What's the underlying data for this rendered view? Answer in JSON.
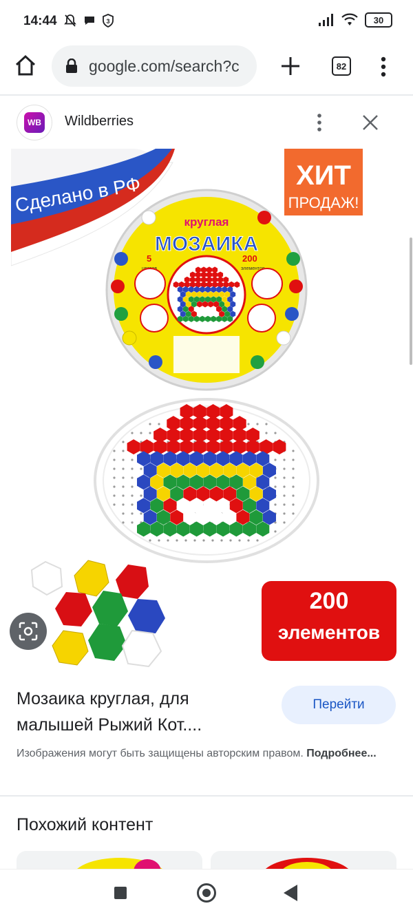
{
  "status_bar": {
    "time": "14:44",
    "battery": "30"
  },
  "browser": {
    "url": "google.com/search?c",
    "tab_count": "82"
  },
  "source": {
    "name": "Wildberries",
    "logo_text": "WB"
  },
  "product_image": {
    "banner_text": "Сделано в РФ",
    "hit_line1": "ХИТ",
    "hit_line2": "ПРОДАЖ!",
    "box_label_small": "круглая",
    "box_label_big": "МОЗАИКА",
    "box_colors_count": "5",
    "box_colors_word": "цветов",
    "box_elements_count": "200",
    "box_elements_word": "элементов",
    "badge_number": "200",
    "badge_word": "элементов"
  },
  "result": {
    "title": "Мозаика круглая, для малышей Рыжий Кот....",
    "go_label": "Перейти",
    "copyright_text": "Изображения могут быть защищены авторским правом. ",
    "copyright_link": "Подробнее..."
  },
  "similar": {
    "title": "Похожий контент"
  },
  "colors": {
    "accent_blue": "#1a56c4",
    "chip_bg": "#e8f0fe",
    "badge_red": "#e01010",
    "hit_orange": "#f26a2e"
  }
}
